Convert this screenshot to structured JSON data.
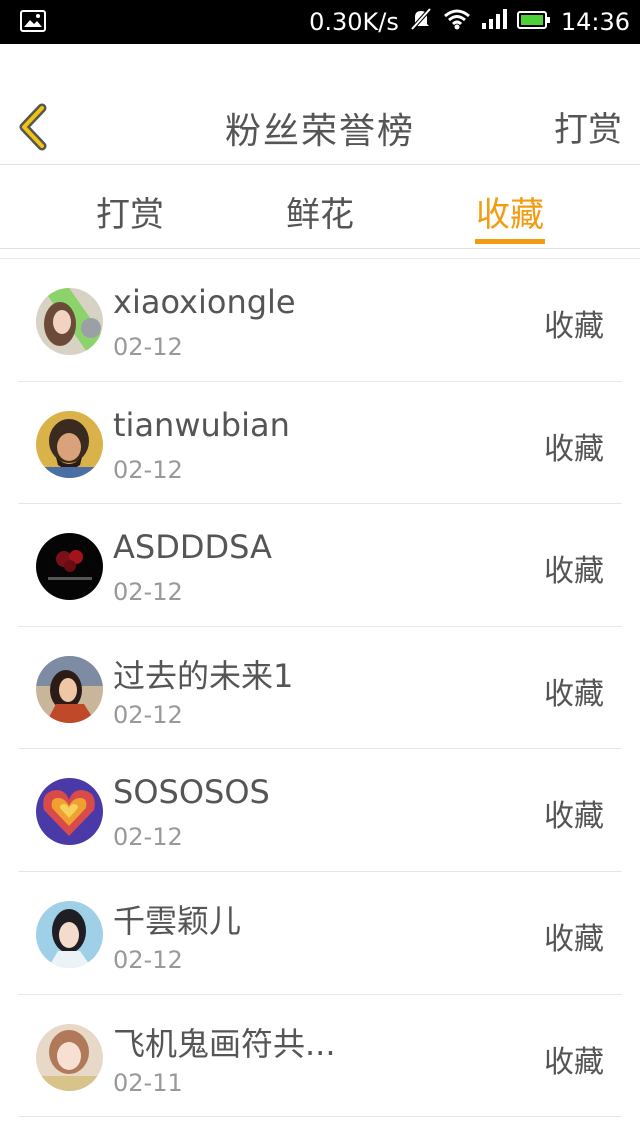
{
  "status_bar": {
    "network_speed": "0.30K/s",
    "time": "14:36",
    "icons": [
      "image-icon",
      "mute-icon",
      "wifi-icon",
      "signal-icon",
      "battery-icon"
    ]
  },
  "nav": {
    "title": "粉丝荣誉榜",
    "right_label": "打赏",
    "back_icon": "chevron-left-icon"
  },
  "tabs": [
    {
      "label": "打赏",
      "active": false
    },
    {
      "label": "鲜花",
      "active": false
    },
    {
      "label": "收藏",
      "active": true
    }
  ],
  "colors": {
    "accent": "#f39c12",
    "text": "#555555",
    "subtext": "#999999",
    "divider": "#e6e6e6"
  },
  "fans": [
    {
      "name": "xiaoxiongle",
      "date": "02-12",
      "type": "收藏"
    },
    {
      "name": "tianwubian",
      "date": "02-12",
      "type": "收藏"
    },
    {
      "name": "ASDDDSA",
      "date": "02-12",
      "type": "收藏"
    },
    {
      "name": "过去的未来1",
      "date": "02-12",
      "type": "收藏"
    },
    {
      "name": "SOSOSOS",
      "date": "02-12",
      "type": "收藏"
    },
    {
      "name": "千雲颖儿",
      "date": "02-12",
      "type": "收藏"
    },
    {
      "name": "飞机鬼画符共...",
      "date": "02-11",
      "type": "收藏"
    }
  ]
}
